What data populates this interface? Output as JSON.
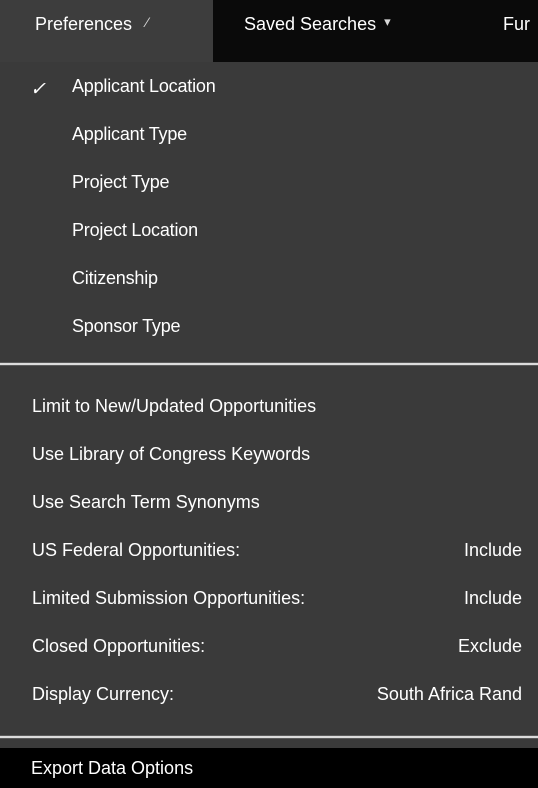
{
  "menubar": {
    "tabs": [
      {
        "label": "Preferences",
        "caret": "⁄"
      },
      {
        "label": "Saved Searches",
        "caret": "▾"
      },
      {
        "label": "Fur"
      }
    ]
  },
  "preferences": {
    "checked_item": "Applicant Location",
    "check_glyph": "✓",
    "items": [
      "Applicant Location",
      "Applicant Type",
      "Project Type",
      "Project Location",
      "Citizenship",
      "Sponsor Type"
    ]
  },
  "options": [
    {
      "label": "Limit to New/Updated Opportunities",
      "value": ""
    },
    {
      "label": "Use Library of Congress Keywords",
      "value": ""
    },
    {
      "label": "Use Search Term Synonyms",
      "value": ""
    },
    {
      "label": "US Federal Opportunities:",
      "value": "Include"
    },
    {
      "label": "Limited Submission Opportunities:",
      "value": "Include"
    },
    {
      "label": "Closed Opportunities:",
      "value": "Exclude"
    },
    {
      "label": "Display Currency:",
      "value": "South Africa Rand"
    }
  ],
  "export": {
    "label": "Export Data Options"
  },
  "colors": {
    "bar": "#0a0a0a",
    "panel": "#3a3a3a",
    "active_tab": "#3d3d3d",
    "text": "#ffffff"
  }
}
